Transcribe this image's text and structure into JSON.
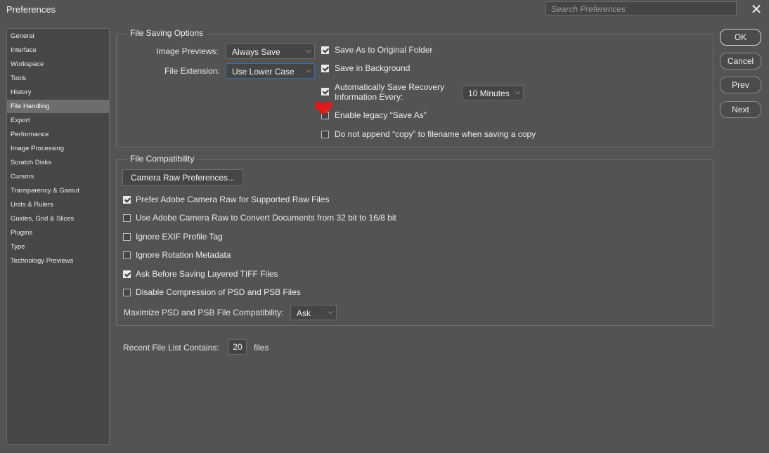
{
  "window": {
    "title": "Preferences",
    "search_placeholder": "Search Preferences",
    "close_glyph": "✕"
  },
  "sidebar": {
    "items": [
      {
        "label": "General"
      },
      {
        "label": "Interface"
      },
      {
        "label": "Workspace"
      },
      {
        "label": "Tools"
      },
      {
        "label": "History"
      },
      {
        "label": "File Handling"
      },
      {
        "label": "Export"
      },
      {
        "label": "Performance"
      },
      {
        "label": "Image Processing"
      },
      {
        "label": "Scratch Disks"
      },
      {
        "label": "Cursors"
      },
      {
        "label": "Transparency & Gamut"
      },
      {
        "label": "Units & Rulers"
      },
      {
        "label": "Guides, Grid & Slices"
      },
      {
        "label": "Plugins"
      },
      {
        "label": "Type"
      },
      {
        "label": "Technology Previews"
      }
    ],
    "selected": "File Handling"
  },
  "file_saving": {
    "legend": "File Saving Options",
    "image_previews_label": "Image Previews:",
    "image_previews_value": "Always Save",
    "file_extension_label": "File Extension:",
    "file_extension_value": "Use Lower Case",
    "save_original_folder": {
      "label": "Save As to Original Folder",
      "checked": true
    },
    "save_background": {
      "label": "Save in Background",
      "checked": true
    },
    "auto_save": {
      "label_line1": "Automatically Save Recovery",
      "label_line2": "Information Every:",
      "checked": true
    },
    "auto_save_interval": "10 Minutes",
    "legacy_save_as": {
      "label": "Enable legacy “Save As”",
      "checked": false
    },
    "no_copy_suffix": {
      "label": "Do not append “copy” to filename when saving a copy",
      "checked": false
    }
  },
  "file_compat": {
    "legend": "File Compatibility",
    "camera_raw_button": "Camera Raw Preferences...",
    "options": [
      {
        "label": "Prefer Adobe Camera Raw for Supported Raw Files",
        "checked": true
      },
      {
        "label": "Use Adobe Camera Raw to Convert Documents from 32 bit to 16/8 bit",
        "checked": false
      },
      {
        "label": "Ignore EXIF Profile Tag",
        "checked": false
      },
      {
        "label": "Ignore Rotation Metadata",
        "checked": false
      },
      {
        "label": "Ask Before Saving Layered TIFF Files",
        "checked": true
      },
      {
        "label": "Disable Compression of PSD and PSB Files",
        "checked": false
      }
    ],
    "maximize_label": "Maximize PSD and PSB File Compatibility:",
    "maximize_value": "Ask"
  },
  "recent": {
    "label": "Recent File List Contains:",
    "value": "20",
    "unit": "files"
  },
  "buttons": {
    "ok": "OK",
    "cancel": "Cancel",
    "prev": "Prev",
    "next": "Next"
  },
  "icons": {
    "chevron": "chevron-down-icon",
    "annotation": "heart-icon"
  },
  "colors": {
    "annotation": "#e01818",
    "focus": "#2f6fbd"
  }
}
